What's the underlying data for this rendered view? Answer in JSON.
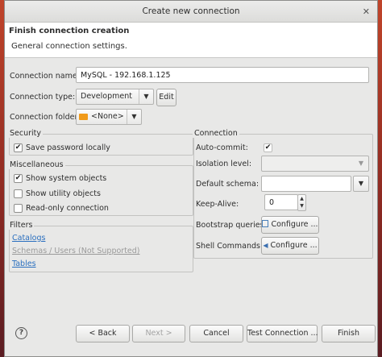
{
  "window": {
    "title": "Create new connection"
  },
  "header": {
    "title": "Finish connection creation",
    "subtitle": "General connection settings."
  },
  "general": {
    "connection_name_label": "Connection name:",
    "connection_name_value": "MySQL - 192.168.1.125",
    "connection_type_label": "Connection type:",
    "connection_type_value": "Development",
    "edit_button": "Edit",
    "connection_folder_label": "Connection folder:",
    "connection_folder_value": "<None>"
  },
  "security": {
    "title": "Security",
    "save_password_label": "Save password locally",
    "save_password_checked": true
  },
  "misc": {
    "title": "Miscellaneous",
    "items": [
      {
        "label": "Show system objects",
        "checked": true
      },
      {
        "label": "Show utility objects",
        "checked": false
      },
      {
        "label": "Read-only connection",
        "checked": false
      }
    ]
  },
  "filters": {
    "title": "Filters",
    "links": [
      {
        "label": "Catalogs",
        "enabled": true
      },
      {
        "label": "Schemas / Users (Not Supported)",
        "enabled": false
      },
      {
        "label": "Tables",
        "enabled": true
      }
    ]
  },
  "connection": {
    "title": "Connection",
    "auto_commit_label": "Auto-commit:",
    "auto_commit_checked": true,
    "isolation_label": "Isolation level:",
    "default_schema_label": "Default schema:",
    "keep_alive_label": "Keep-Alive:",
    "keep_alive_value": "0",
    "bootstrap_label": "Bootstrap queries:",
    "shell_label": "Shell Commands:",
    "configure_label": "Configure ..."
  },
  "footer": {
    "help": "?",
    "back": "< Back",
    "next": "Next >",
    "cancel": "Cancel",
    "test": "Test Connection ...",
    "finish": "Finish"
  }
}
